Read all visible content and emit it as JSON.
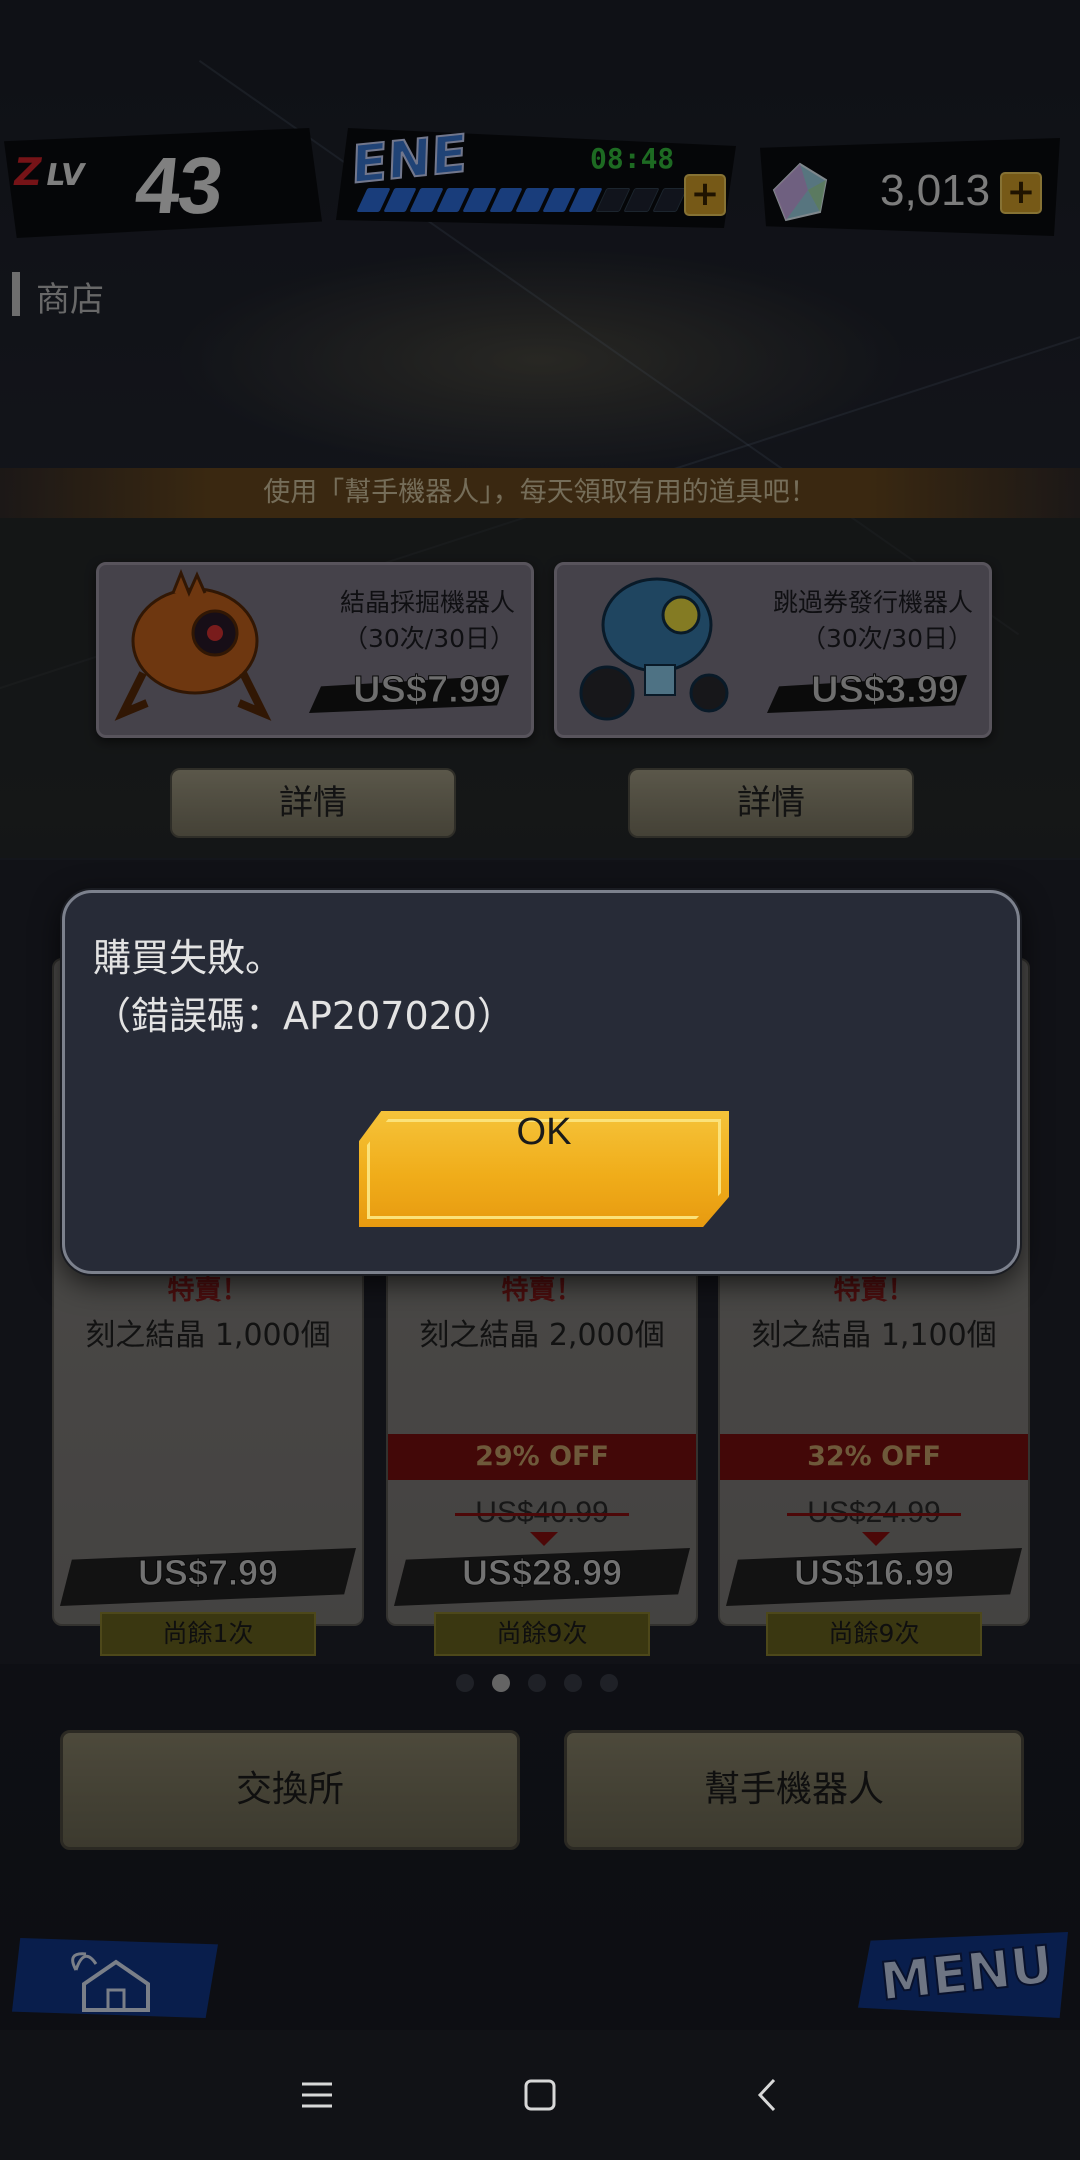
{
  "hud": {
    "level_prefix": "Z",
    "level_label": "LV",
    "level_value": "43",
    "energy_label": "ENE",
    "energy_timer": "08:48",
    "energy_fraction": 0.75,
    "gem_count": "3,013",
    "plus_symbol": "+"
  },
  "header": {
    "title": "商店"
  },
  "banner": {
    "text": "使用「幫手機器人」，每天領取有用的道具吧！"
  },
  "robots": [
    {
      "name_line1": "結晶採掘機器人",
      "name_line2": "（30次/30日）",
      "price": "US$7.99",
      "detail_label": "詳情"
    },
    {
      "name_line1": "跳過券發行機器人",
      "name_line2": "（30次/30日）",
      "price": "US$3.99",
      "detail_label": "詳情"
    }
  ],
  "offers": [
    {
      "tag": "特賣！",
      "title": "刻之結晶 1,000個",
      "price": "US$7.99",
      "remaining": "尚餘1次"
    },
    {
      "tag": "特賣！",
      "title": "刻之結晶 2,000個",
      "discount": "29% OFF",
      "old_price": "US$40.99",
      "price": "US$28.99",
      "remaining": "尚餘9次"
    },
    {
      "tag": "特賣！",
      "title": "刻之結晶 1,100個",
      "discount": "32% OFF",
      "old_price": "US$24.99",
      "price": "US$16.99",
      "remaining": "尚餘9次"
    }
  ],
  "pager": {
    "count": 5,
    "active_index": 1
  },
  "bottom_buttons": {
    "exchange_label": "交換所",
    "helper_robot_label": "幫手機器人"
  },
  "corner": {
    "menu_label": "MENU"
  },
  "dialog": {
    "message_line1": "購買失敗。",
    "message_line2": "（錯誤碼：AP207020）",
    "ok_label": "OK"
  },
  "colors": {
    "accent_gold": "#f0ad1a",
    "dialog_bg": "#272b37",
    "energy_blue": "#2f6fe0",
    "sale_red": "#7a1010"
  }
}
